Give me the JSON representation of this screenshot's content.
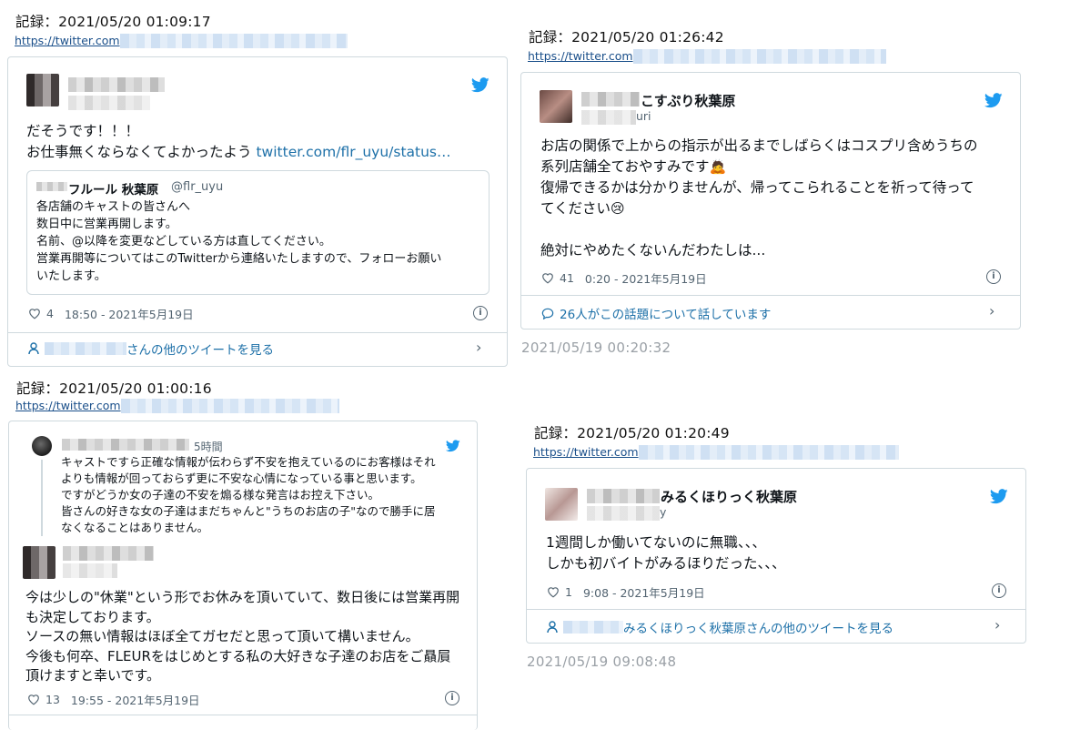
{
  "tl": {
    "record": "記録：2021/05/20 01:09:17",
    "link": "https://twitter.com",
    "text_lines": [
      "だそうです！！！",
      "お仕事無くならなくてよかったよう"
    ],
    "text_link": "twitter.com/flr_uyu/status…",
    "quote": {
      "name": "フルール 秋葉原",
      "handle": "@flr_uyu",
      "lines": [
        "各店舗のキャストの皆さんへ",
        "数日中に営業再開します。",
        "名前、@以降を変更などしている方は直してください。",
        "営業再開等についてはこのTwitterから連絡いたしますので、フォローお願い",
        "いたします。"
      ]
    },
    "likes": "4",
    "time": "18:50 - 2021年5月19日",
    "footer": "さんの他のツイートを見る"
  },
  "tr": {
    "record": "記録：2021/05/20 01:26:42",
    "link": "https://twitter.com",
    "name": "こすぷり秋葉原",
    "handle": "uri",
    "text_lines": [
      "お店の関係で上からの指示が出るまでしばらくはコスプリ含めうちの",
      "系列店舗全ておやすみです",
      "復帰できるかは分かりませんが、帰ってこられることを祈って待って",
      "てください",
      "",
      "絶対にやめたくないんだわたしは..."
    ],
    "likes": "41",
    "time": "0:20 - 2021年5月19日",
    "footer": "26人がこの話題について話しています",
    "stamp": "2021/05/19 00:20:32"
  },
  "bl": {
    "record": "記録：2021/05/20 01:00:16",
    "link": "https://twitter.com",
    "reply_time": "5時間",
    "reply_lines": [
      "キャストですら正確な情報が伝わらず不安を抱えているのにお客様はそれ",
      "よりも情報が回っておらず更に不安な心情になっている事と思います。",
      "ですがどうか女の子達の不安を煽る様な発言はお控え下さい。",
      "皆さんの好きな女の子達はまだちゃんと\"うちのお店の子\"なので勝手に居",
      "なくなることはありません。"
    ],
    "text_lines": [
      "今は少しの\"休業\"という形でお休みを頂いていて、数日後には営業再開",
      "も決定しております。",
      "ソースの無い情報はほぼ全てガセだと思って頂いて構いません。",
      "今後も何卒、FLEURをはじめとする私の大好きな子達のお店をご贔屓",
      "頂けますと幸いです。"
    ],
    "likes": "13",
    "time": "19:55 - 2021年5月19日"
  },
  "br": {
    "record": "記録：2021/05/20 01:20:49",
    "link": "https://twitter.com",
    "name": "みるくほりっく秋葉原",
    "handle": "y",
    "text_lines": [
      "1週間しか働いてないのに無職、、、",
      "しかも初バイトがみるほりだった、、、"
    ],
    "likes": "1",
    "time": "9:08 - 2021年5月19日",
    "footer": "みるくほりっく秋葉原さんの他のツイートを見る",
    "stamp": "2021/05/19 09:08:48"
  },
  "colors": {
    "twitter_blue": "#1d9bf0",
    "link": "#1d70a8",
    "stamp": "#9aa0a6"
  },
  "icons": [
    "twitter-bird-icon",
    "heart-icon",
    "info-icon",
    "user-icon",
    "chevron-right-icon",
    "speech-bubble-icon"
  ]
}
